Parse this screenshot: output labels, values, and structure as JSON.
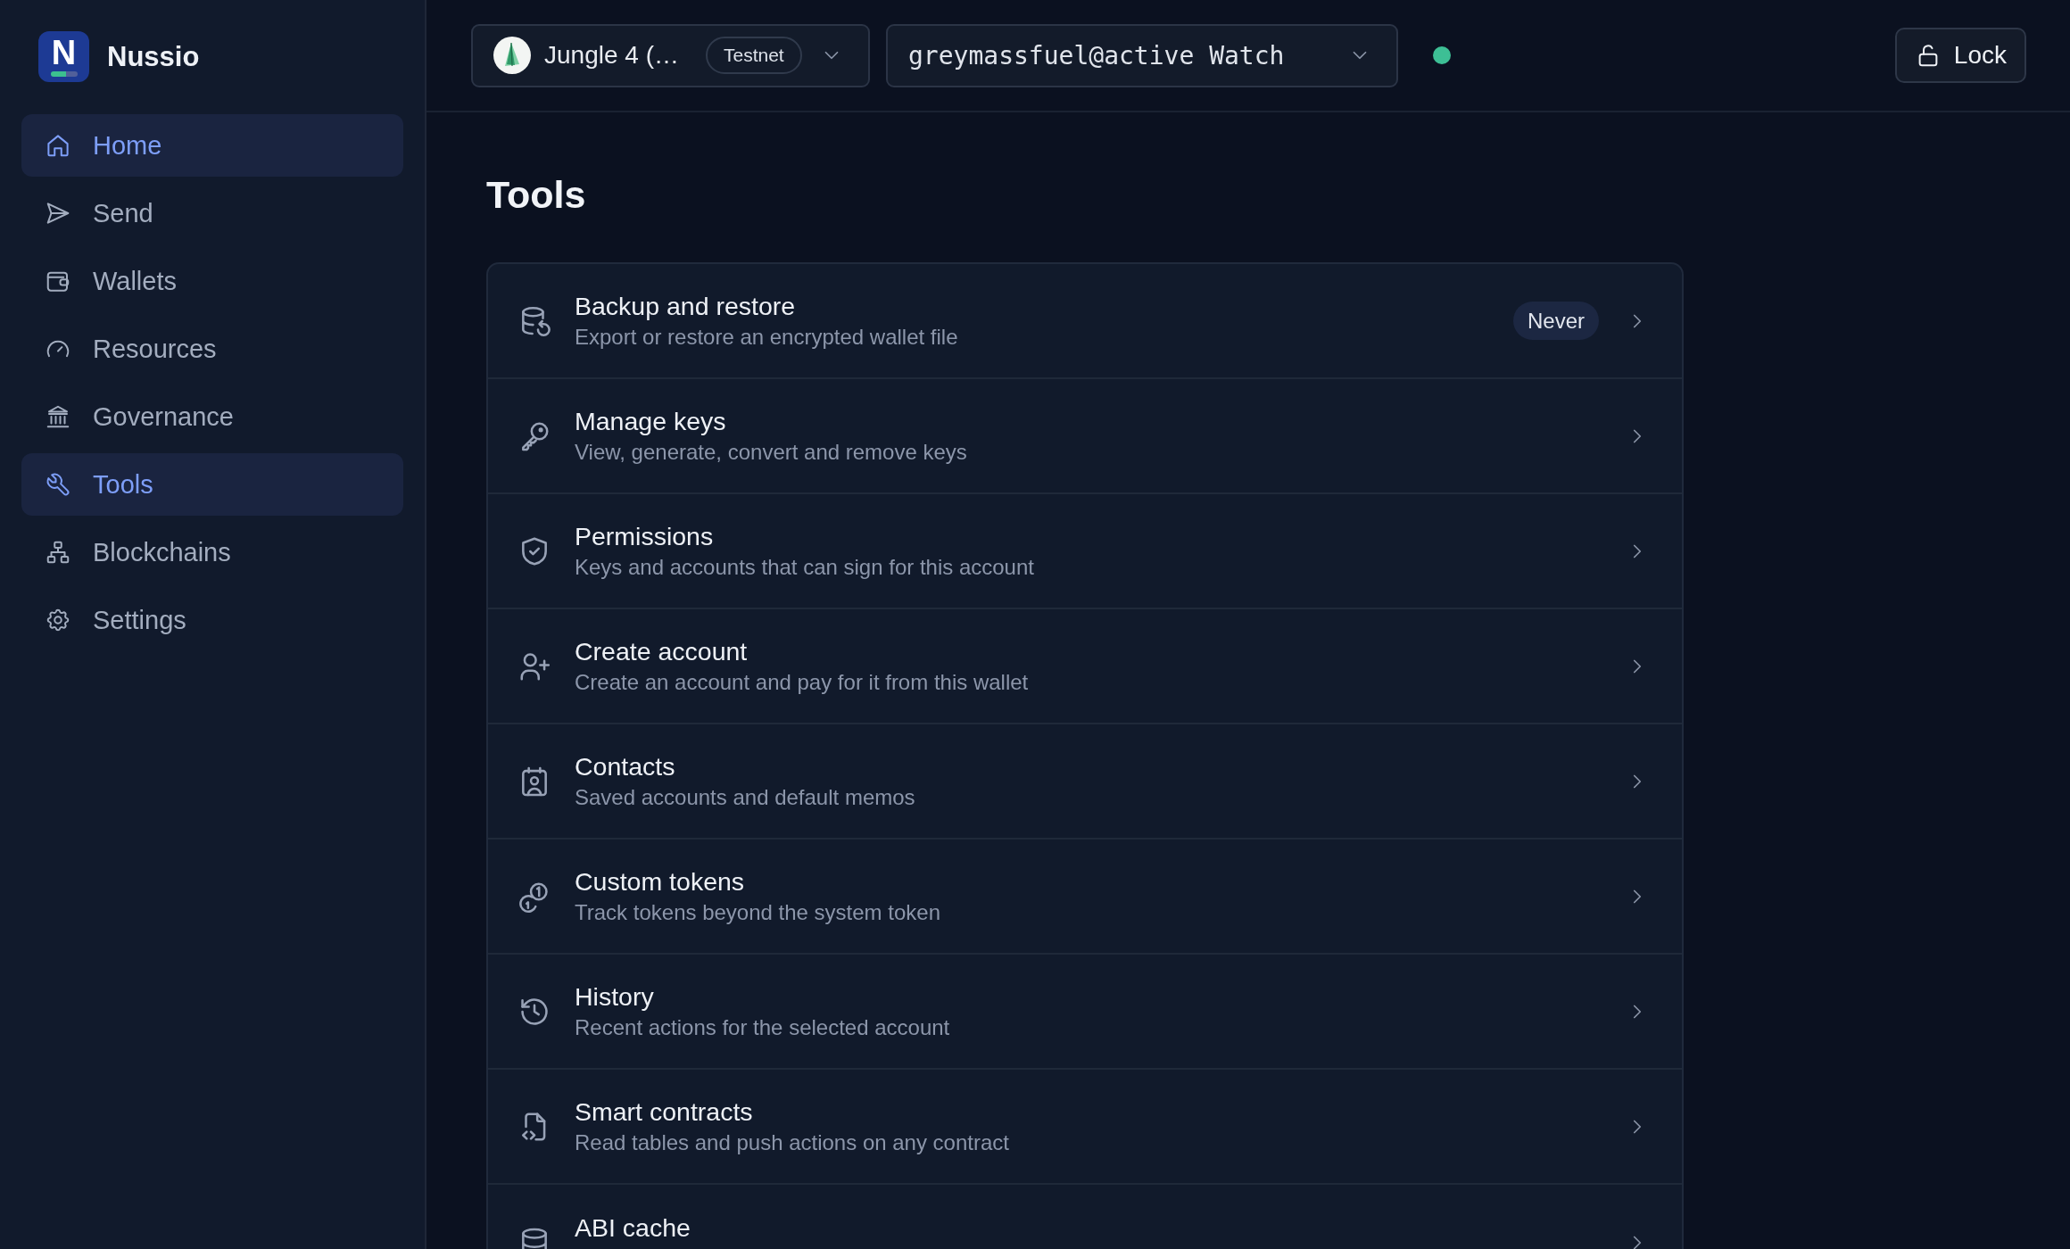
{
  "brand": {
    "logo_letter": "N",
    "name": "Nussio"
  },
  "sidebar": {
    "items": [
      {
        "label": "Home",
        "selected": true
      },
      {
        "label": "Send",
        "selected": false
      },
      {
        "label": "Wallets",
        "selected": false
      },
      {
        "label": "Resources",
        "selected": false
      },
      {
        "label": "Governance",
        "selected": false
      },
      {
        "label": "Tools",
        "selected": true
      },
      {
        "label": "Blockchains",
        "selected": false
      },
      {
        "label": "Settings",
        "selected": false
      }
    ]
  },
  "topbar": {
    "network": {
      "name": "Jungle 4 (…",
      "badge": "Testnet"
    },
    "account": {
      "value": "greymassfuel@active Watch"
    },
    "status": {
      "connected": true
    },
    "lock_button": "Lock"
  },
  "page": {
    "title": "Tools"
  },
  "tools": [
    {
      "title": "Backup and restore",
      "description": "Export or restore an encrypted wallet file",
      "badge": "Never"
    },
    {
      "title": "Manage keys",
      "description": "View, generate, convert and remove keys"
    },
    {
      "title": "Permissions",
      "description": "Keys and accounts that can sign for this account"
    },
    {
      "title": "Create account",
      "description": "Create an account and pay for it from this wallet"
    },
    {
      "title": "Contacts",
      "description": "Saved accounts and default memos"
    },
    {
      "title": "Custom tokens",
      "description": "Track tokens beyond the system token"
    },
    {
      "title": "History",
      "description": "Recent actions for the selected account"
    },
    {
      "title": "Smart contracts",
      "description": "Read tables and push actions on any contract"
    },
    {
      "title": "ABI cache"
    }
  ]
}
